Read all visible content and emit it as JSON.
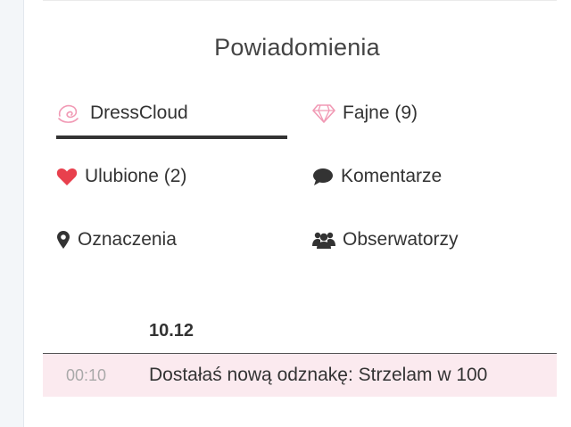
{
  "page": {
    "title": "Powiadomienia"
  },
  "tabs": [
    {
      "label": "DressCloud",
      "icon": "dresscloud-logo-icon",
      "active": true
    },
    {
      "label": "Fajne (9)",
      "icon": "diamond-icon",
      "active": false
    },
    {
      "label": "Ulubione (2)",
      "icon": "heart-icon",
      "active": false
    },
    {
      "label": "Komentarze",
      "icon": "comment-icon",
      "active": false
    },
    {
      "label": "Oznaczenia",
      "icon": "map-marker-icon",
      "active": false
    },
    {
      "label": "Obserwatorzy",
      "icon": "users-icon",
      "active": false
    }
  ],
  "notifications": {
    "date": "10.12",
    "items": [
      {
        "time": "00:10",
        "message": "Dostałaś nową odznakę: Strzelam w 100"
      }
    ]
  },
  "colors": {
    "accent_pink": "#f19ab5",
    "heart_red": "#e8404d",
    "highlight_row": "#fbeaef",
    "text_dark": "#333333"
  }
}
